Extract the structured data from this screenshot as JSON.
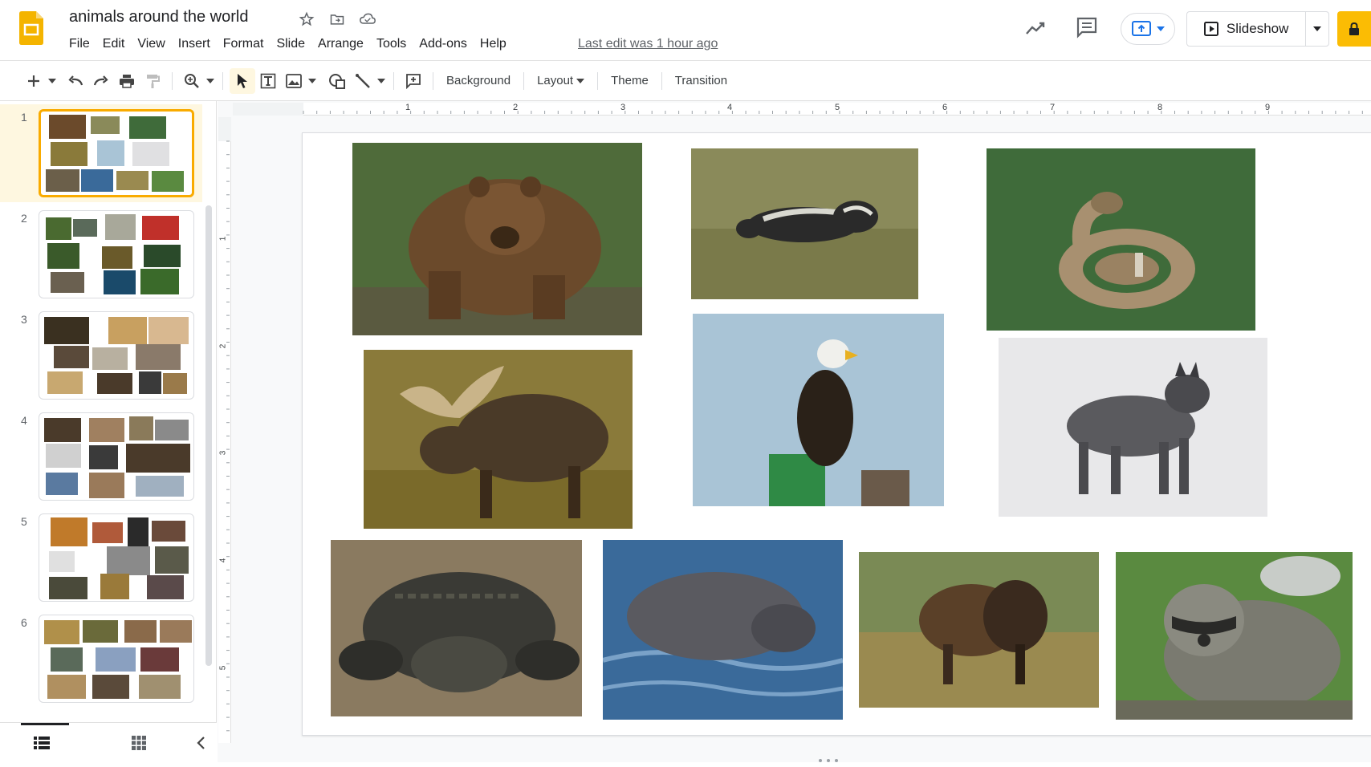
{
  "doc": {
    "title": "animals around the world",
    "last_edit": "Last edit was 1 hour ago"
  },
  "menu": [
    "File",
    "Edit",
    "View",
    "Insert",
    "Format",
    "Slide",
    "Arrange",
    "Tools",
    "Add-ons",
    "Help"
  ],
  "header": {
    "slideshow_label": "Slideshow"
  },
  "toolbar": {
    "background_label": "Background",
    "layout_label": "Layout",
    "theme_label": "Theme",
    "transition_label": "Transition"
  },
  "ruler": {
    "h_numbers": [
      "1",
      "2",
      "3",
      "4",
      "5",
      "6",
      "7",
      "8",
      "9"
    ],
    "v_numbers": [
      "1",
      "2",
      "3",
      "4",
      "5"
    ]
  },
  "filmstrip": {
    "slides": [
      {
        "number": "1",
        "selected": true
      },
      {
        "number": "2",
        "selected": false
      },
      {
        "number": "3",
        "selected": false
      },
      {
        "number": "4",
        "selected": false
      },
      {
        "number": "5",
        "selected": false
      },
      {
        "number": "6",
        "selected": false
      }
    ]
  },
  "slide_photos": [
    {
      "name": "grizzly-bear-photo",
      "colors": [
        "#6b4a2b",
        "#4f6b3a",
        "#8a6a45"
      ]
    },
    {
      "name": "skunk-photo",
      "colors": [
        "#8a8a5a",
        "#2a2a2a",
        "#d8d8d0"
      ]
    },
    {
      "name": "rattlesnake-photo",
      "colors": [
        "#3f6b3a",
        "#a89070",
        "#2f5030"
      ]
    },
    {
      "name": "moose-photo",
      "colors": [
        "#8a7a3a",
        "#4a3a28",
        "#c9b489"
      ]
    },
    {
      "name": "bald-eagle-photo",
      "colors": [
        "#a9c4d6",
        "#2a2118",
        "#2f8a45"
      ]
    },
    {
      "name": "gray-wolf-photo",
      "colors": [
        "#e8e8ea",
        "#5a5a5e",
        "#2a2a2e"
      ]
    },
    {
      "name": "alligator-photo",
      "colors": [
        "#8a7a60",
        "#3a3a35",
        "#6b5f4a"
      ]
    },
    {
      "name": "beaver-photo",
      "colors": [
        "#3a6a9a",
        "#5a5a60",
        "#7aa2c8"
      ]
    },
    {
      "name": "bison-photo",
      "colors": [
        "#9a8a50",
        "#3a2a1e",
        "#7a8a55"
      ]
    },
    {
      "name": "raccoon-photo",
      "colors": [
        "#5a8a40",
        "#7a7a70",
        "#2a2a28"
      ]
    }
  ]
}
